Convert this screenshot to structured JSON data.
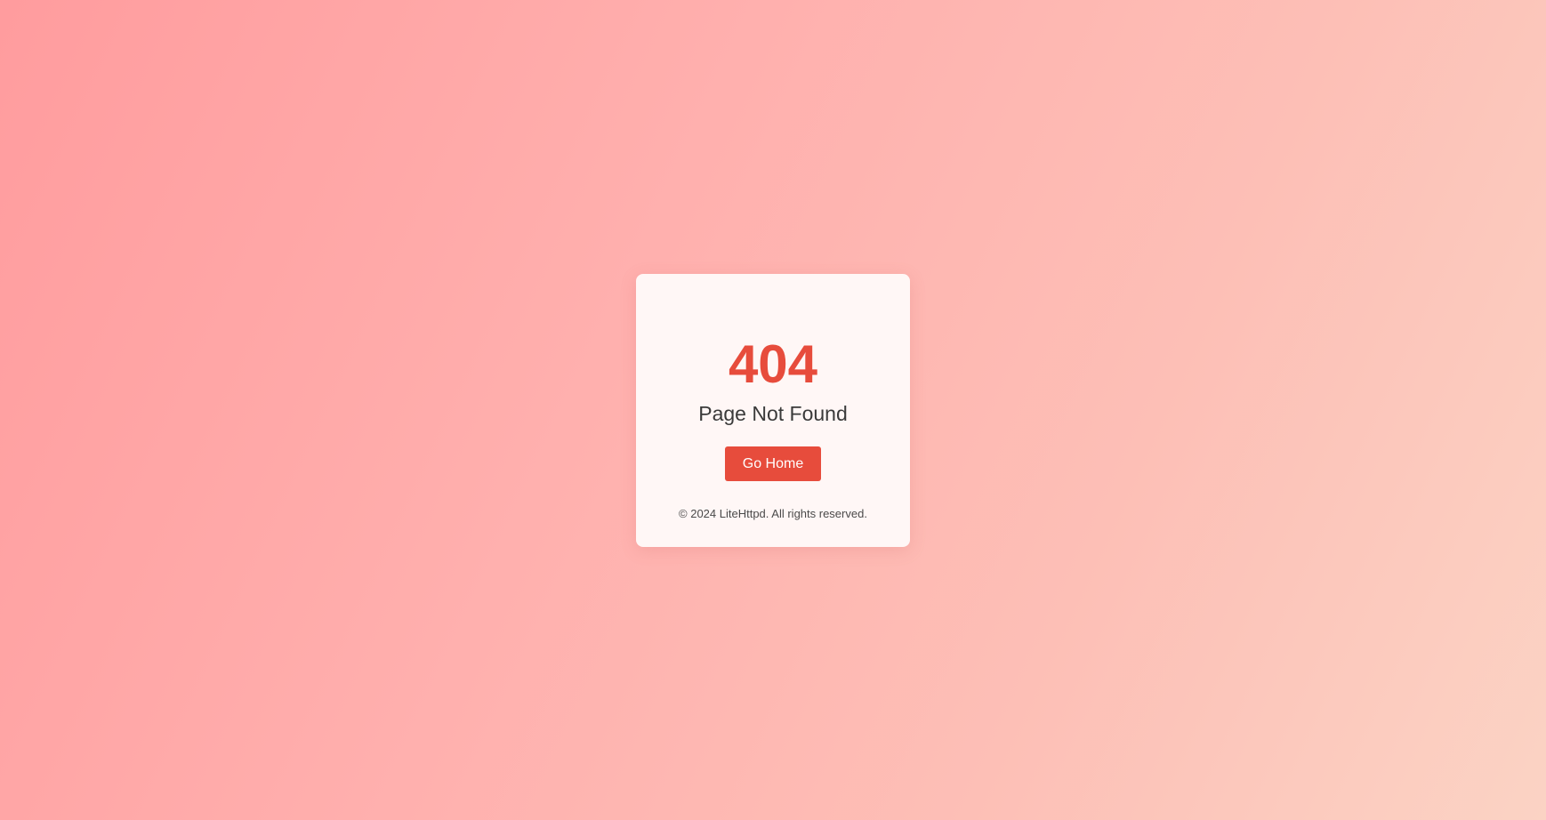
{
  "error": {
    "code": "404",
    "message": "Page Not Found"
  },
  "actions": {
    "home_label": "Go Home"
  },
  "footer": {
    "copyright": "© 2024 LiteHttpd. All rights reserved."
  },
  "colors": {
    "accent": "#e74c3c",
    "card_background": "#fff7f6",
    "text": "#3a3a3a"
  }
}
